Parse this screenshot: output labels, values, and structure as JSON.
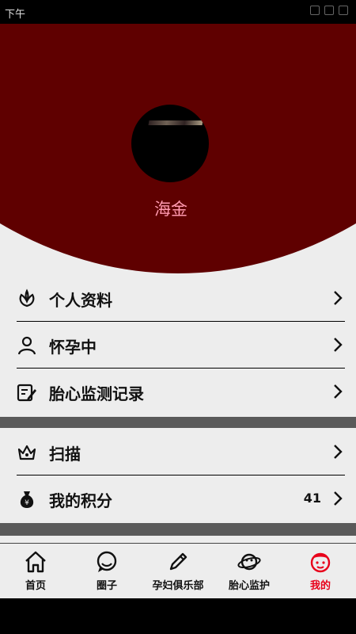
{
  "status_bar": {
    "time": "下午"
  },
  "profile": {
    "username": "海金"
  },
  "menu_group_1": [
    {
      "label": "个人资料",
      "icon": "flower-icon"
    },
    {
      "label": "怀孕中",
      "icon": "person-icon"
    },
    {
      "label": "胎心监测记录",
      "icon": "record-edit-icon"
    }
  ],
  "menu_group_2": [
    {
      "label": "扫描",
      "icon": "scan-crown-icon",
      "value": ""
    },
    {
      "label": "我的积分",
      "icon": "money-bag-icon",
      "value": "41"
    }
  ],
  "bottom_nav": [
    {
      "label": "首页",
      "icon": "home-icon",
      "active": false
    },
    {
      "label": "圈子",
      "icon": "chat-bubble-icon",
      "active": false
    },
    {
      "label": "孕妇俱乐部",
      "icon": "pencil-icon",
      "active": false
    },
    {
      "label": "胎心监护",
      "icon": "planet-icon",
      "active": false
    },
    {
      "label": "我的",
      "icon": "profile-face-icon",
      "active": true
    }
  ],
  "colors": {
    "header_bg": "#5f0000",
    "username": "#ff9ab0",
    "active_nav": "#e8001a",
    "separator": "#5a5a5a"
  }
}
